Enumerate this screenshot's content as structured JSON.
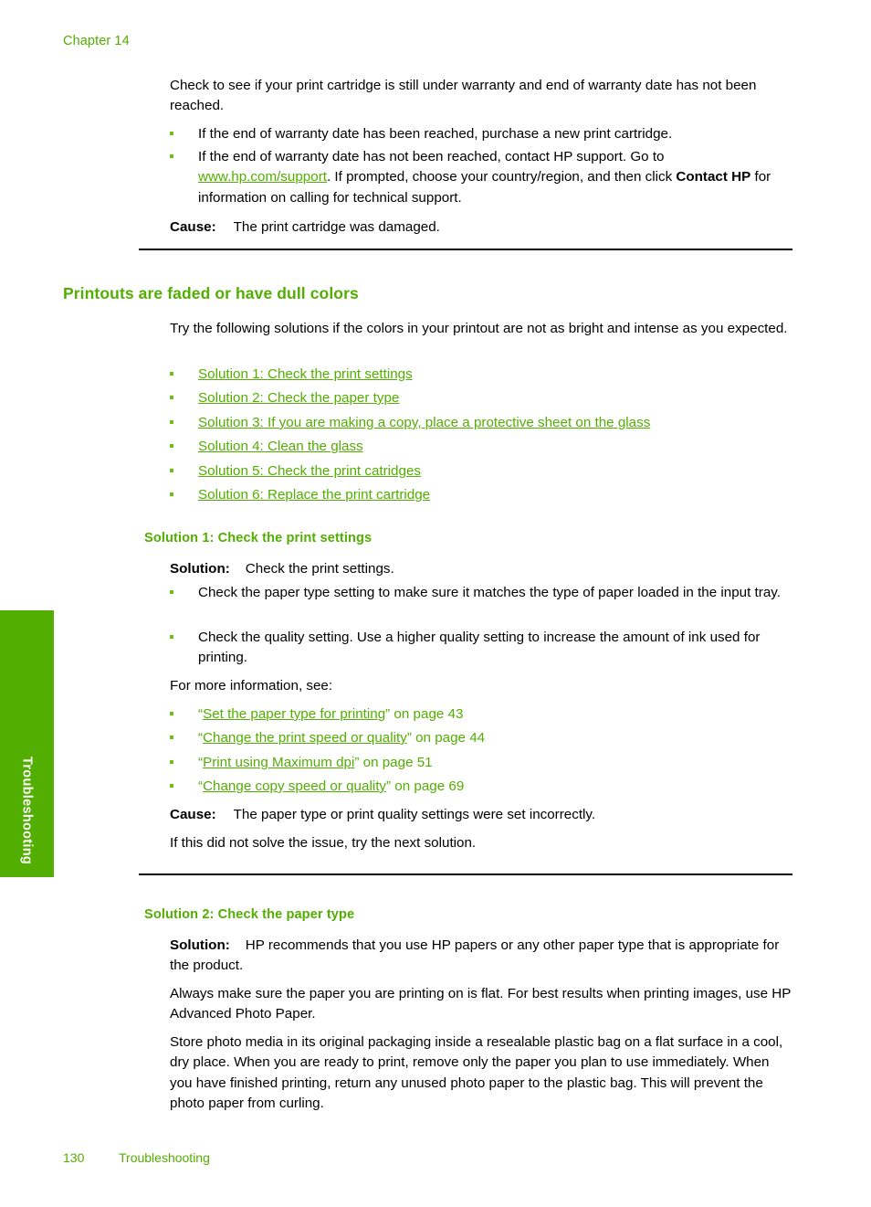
{
  "header": {
    "chapter": "Chapter 14"
  },
  "side_tab": {
    "label": "Troubleshooting",
    "color": "#52ae00"
  },
  "footer": {
    "page_number": "130",
    "section": "Troubleshooting"
  },
  "colors": {
    "heading_green": "#52ae00",
    "link_green": "#52ae00",
    "bullet_green": "#6fbf1a",
    "body_black": "#000000"
  },
  "top_section": {
    "intro": "Check to see if your print cartridge is still under warranty and end of warranty date has not been reached.",
    "bullets": [
      "If the end of warranty date has been reached, purchase a new print cartridge.",
      {
        "pre": "If the end of warranty date has not been reached, contact HP support. Go to ",
        "link": "www.hp.com/support",
        "mid": ". If prompted, choose your country/region, and then click ",
        "bold": "Contact HP",
        "post": " for information on calling for technical support."
      }
    ],
    "cause_label": "Cause:",
    "cause_text": "The print cartridge was damaged."
  },
  "main_section": {
    "title": "Printouts are faded or have dull colors",
    "intro": "Try the following solutions if the colors in your printout are not as bright and intense as you expected.",
    "toc_links": [
      "Solution 1: Check the print settings",
      "Solution 2: Check the paper type",
      "Solution 3: If you are making a copy, place a protective sheet on the glass",
      "Solution 4: Clean the glass",
      "Solution 5: Check the print catridges",
      "Solution 6: Replace the print cartridge"
    ]
  },
  "solution1": {
    "heading": "Solution 1: Check the print settings",
    "solution_label": "Solution:",
    "solution_text": "Check the print settings.",
    "bullets": [
      "Check the paper type setting to make sure it matches the type of paper loaded in the input tray.",
      "Check the quality setting. Use a higher quality setting to increase the amount of ink used for printing."
    ],
    "more_info_label": "For more information, see:",
    "references": [
      {
        "open_quote": "“",
        "link": "Set the paper type for printing",
        "close": "” on page 43"
      },
      {
        "open_quote": "“",
        "link": "Change the print speed or quality",
        "close": "” on page 44"
      },
      {
        "open_quote": "“",
        "link": "Print using Maximum dpi",
        "close": "” on page 51"
      },
      {
        "open_quote": "“",
        "link": "Change copy speed or quality",
        "close": "” on page 69"
      }
    ],
    "cause_label": "Cause:",
    "cause_text": "The paper type or print quality settings were set incorrectly.",
    "next_text": "If this did not solve the issue, try the next solution."
  },
  "solution2": {
    "heading": "Solution 2: Check the paper type",
    "solution_label": "Solution:",
    "solution_text": "HP recommends that you use HP papers or any other paper type that is appropriate for the product.",
    "paragraph2": "Always make sure the paper you are printing on is flat. For best results when printing images, use HP Advanced Photo Paper.",
    "paragraph3": "Store photo media in its original packaging inside a resealable plastic bag on a flat surface in a cool, dry place. When you are ready to print, remove only the paper you plan to use immediately. When you have finished printing, return any unused photo paper to the plastic bag. This will prevent the photo paper from curling."
  }
}
